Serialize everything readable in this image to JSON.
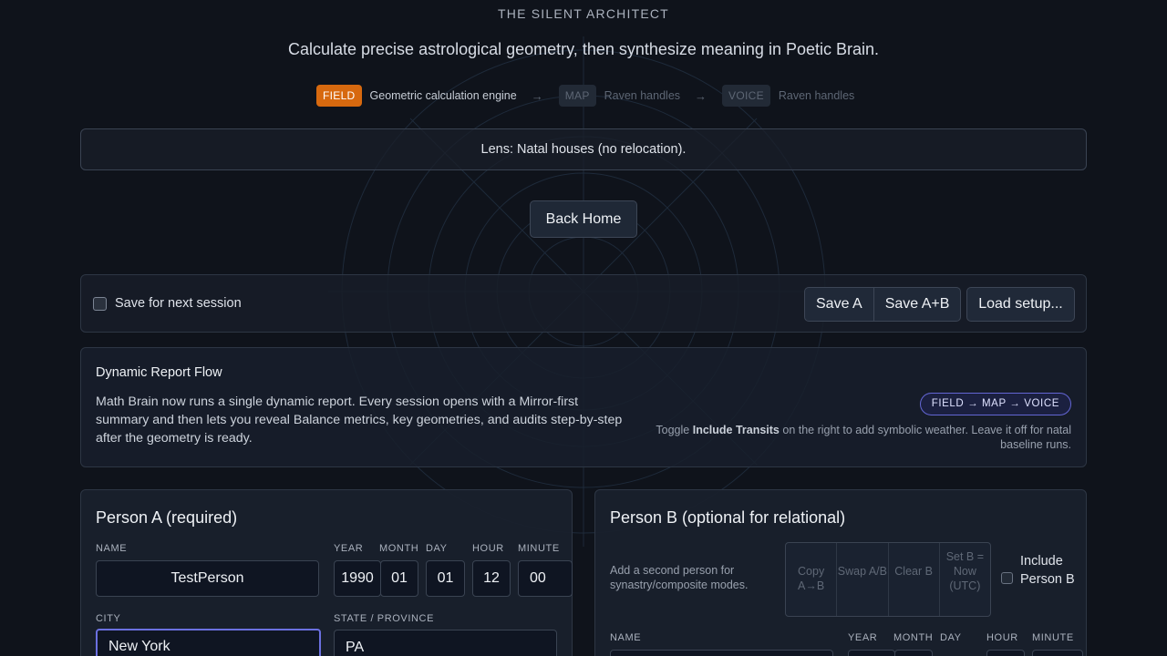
{
  "header": {
    "brand": "THE SILENT ARCHITECT",
    "tagline": "Calculate precise astrological geometry, then synthesize meaning in Poetic Brain."
  },
  "steps": [
    {
      "badge": "FIELD",
      "desc": "Geometric calculation engine",
      "active": true
    },
    {
      "badge": "MAP",
      "desc": "Raven handles",
      "active": false
    },
    {
      "badge": "VOICE",
      "desc": "Raven handles",
      "active": false
    }
  ],
  "step_arrow": "→",
  "lens": "Lens: Natal houses (no relocation).",
  "back_home": "Back Home",
  "session": {
    "save_label": "Save for next session",
    "save_checked": false,
    "save_a": "Save A",
    "save_ab": "Save A+B",
    "load": "Load setup..."
  },
  "flow": {
    "title": "Dynamic Report Flow",
    "body": "Math Brain now runs a single dynamic report. Every session opens with a Mirror-first summary and then lets you reveal Balance metrics, key geometries, and audits step-by-step after the geometry is ready.",
    "pill": "FIELD → MAP → VOICE",
    "note_pre": "Toggle ",
    "note_strong": "Include Transits",
    "note_post": " on the right to add symbolic weather. Leave it off for natal baseline runs."
  },
  "person_a": {
    "title": "Person A (required)",
    "labels": {
      "name": "NAME",
      "year": "YEAR",
      "month": "MONTH",
      "day": "DAY",
      "hour": "HOUR",
      "minute": "MINUTE",
      "city": "CITY",
      "state": "STATE / PROVINCE"
    },
    "values": {
      "name": "TestPerson",
      "year": "1990",
      "month": "01",
      "day": "01",
      "hour": "12",
      "minute": "00",
      "city": "New York",
      "state": "PA"
    }
  },
  "person_b": {
    "title": "Person B (optional for relational)",
    "help": "Add a second person for synastry/composite modes.",
    "actions": [
      "Copy A→B",
      "Swap A/B",
      "Clear B",
      "Set B = Now (UTC)"
    ],
    "include_label": "Include Person B",
    "include_checked": false,
    "labels": {
      "name": "NAME",
      "year": "YEAR",
      "month": "MONTH",
      "day": "DAY",
      "hour": "HOUR",
      "minute": "MINUTE"
    }
  },
  "colors": {
    "background": "#0f131b",
    "accent_orange": "#d7690f",
    "accent_indigo": "#6366d4"
  }
}
